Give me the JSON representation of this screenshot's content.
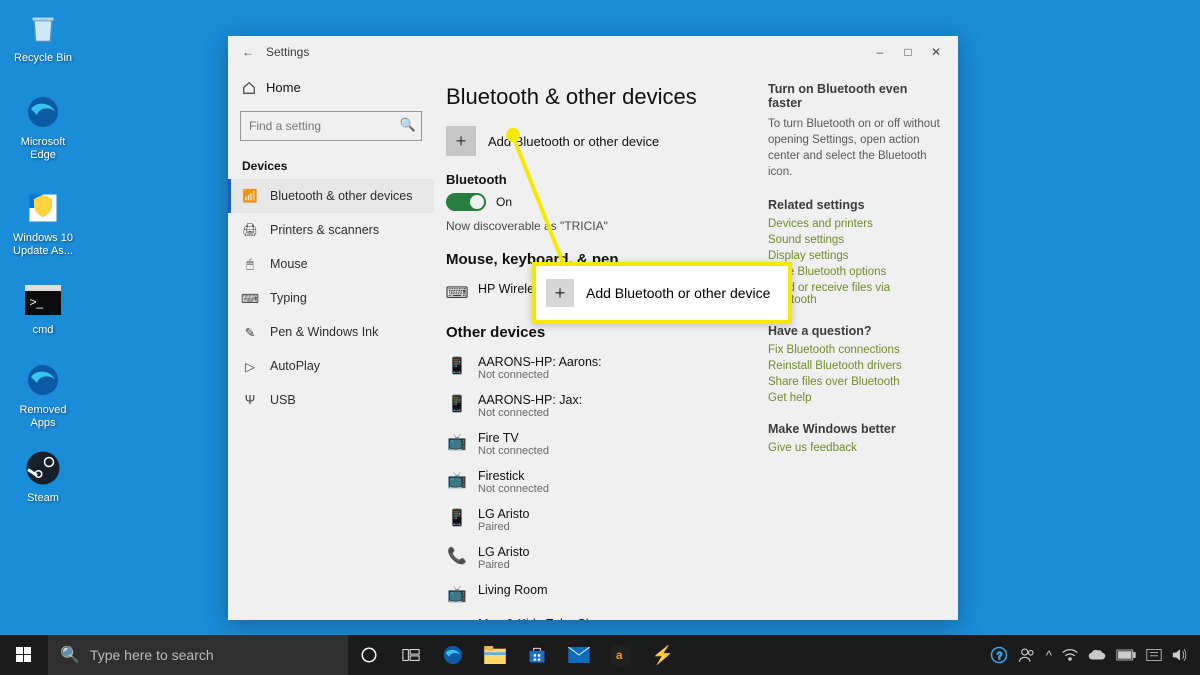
{
  "desktop_icons": [
    {
      "label": "Recycle Bin"
    },
    {
      "label": "Microsoft Edge"
    },
    {
      "label": "Windows 10 Update As..."
    },
    {
      "label": "cmd"
    },
    {
      "label": "Removed Apps"
    },
    {
      "label": "Steam"
    }
  ],
  "window": {
    "title": "Settings",
    "home_label": "Home",
    "search_placeholder": "Find a setting",
    "section_label": "Devices",
    "nav": [
      "Bluetooth & other devices",
      "Printers & scanners",
      "Mouse",
      "Typing",
      "Pen & Windows Ink",
      "AutoPlay",
      "USB"
    ],
    "page_title": "Bluetooth & other devices",
    "add_label": "Add Bluetooth or other device",
    "bluetooth_heading": "Bluetooth",
    "toggle_on": "On",
    "discoverable": "Now discoverable as \"TRICIA\"",
    "mouse_section": "Mouse, keyboard, & pen",
    "mouse_device": {
      "name": "HP Wireless Keyboard",
      "status": ""
    },
    "other_section": "Other devices",
    "other_devices": [
      {
        "name": "AARONS-HP: Aarons:",
        "status": "Not connected"
      },
      {
        "name": "AARONS-HP: Jax:",
        "status": "Not connected"
      },
      {
        "name": "Fire TV",
        "status": "Not connected"
      },
      {
        "name": "Firestick",
        "status": "Not connected"
      },
      {
        "name": "LG Aristo",
        "status": "Paired"
      },
      {
        "name": "LG Aristo",
        "status": "Paired"
      },
      {
        "name": "Living Room",
        "status": ""
      },
      {
        "name": "Meg & Kids Echo Show",
        "status": ""
      }
    ],
    "side": {
      "tip_h": "Turn on Bluetooth even faster",
      "tip_p": "To turn Bluetooth on or off without opening Settings, open action center and select the Bluetooth icon.",
      "related_h": "Related settings",
      "related": [
        "Devices and printers",
        "Sound settings",
        "Display settings",
        "More Bluetooth options",
        "Send or receive files via Bluetooth"
      ],
      "q_h": "Have a question?",
      "q_links": [
        "Fix Bluetooth connections",
        "Reinstall Bluetooth drivers",
        "Share files over Bluetooth",
        "Get help"
      ],
      "better_h": "Make Windows better",
      "better_link": "Give us feedback"
    }
  },
  "callout_text": "Add Bluetooth or other device",
  "taskbar": {
    "search_placeholder": "Type here to search"
  }
}
